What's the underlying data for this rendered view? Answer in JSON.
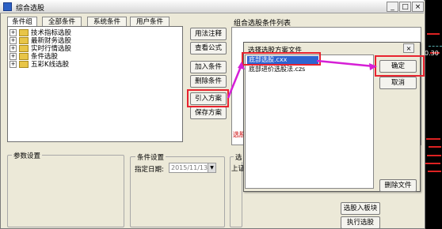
{
  "window": {
    "title": "综合选股",
    "minimize_label": "_",
    "maximize_label": "□",
    "close_label": "×"
  },
  "tabs": [
    "条件组",
    "全部条件",
    "系统条件",
    "用户条件"
  ],
  "tree": [
    {
      "label": "技术指标选股",
      "toggle": "+"
    },
    {
      "label": "最新财务选股",
      "toggle": "+"
    },
    {
      "label": "实时行情选股",
      "toggle": "+"
    },
    {
      "label": "条件选股",
      "toggle": "+"
    },
    {
      "label": "五彩K线选股",
      "toggle": "+"
    }
  ],
  "buttons": {
    "usage_note": "用法注释",
    "view_formula": "查看公式",
    "add_condition": "加入条件",
    "delete_condition": "删除条件",
    "import_scheme": "引入方案",
    "save_scheme": "保存方案",
    "select_into_block": "选股入板块",
    "execute": "执行选股"
  },
  "condition_list": {
    "label": "组合选股条件列表",
    "hint": "选股"
  },
  "params": {
    "label": "参数设置"
  },
  "conditions": {
    "label": "条件设置",
    "date_label": "指定日期:",
    "date_value": "2015/11/13"
  },
  "select_group": {
    "label": "选",
    "sub_label": "上证"
  },
  "dialog": {
    "title": "选择选股方案文件",
    "files": [
      "底部选股.cxx",
      "底部进价选股法.czs"
    ],
    "ok": "确定",
    "cancel": "取消",
    "delete_file": "删除文件",
    "close": "×"
  },
  "background_chart": {
    "value_label": "0.30",
    "accent_color": "#e8232f"
  },
  "highlight_color": "#e8232f",
  "arrow_color": "#d61fd6"
}
